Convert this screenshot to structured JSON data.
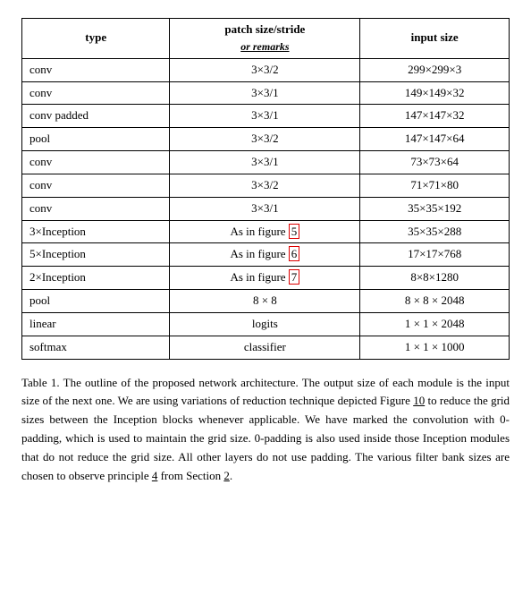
{
  "table": {
    "headers": [
      {
        "label": "type",
        "subLabel": ""
      },
      {
        "label": "patch size/stride",
        "subLabel": "or remarks"
      },
      {
        "label": "input size",
        "subLabel": ""
      }
    ],
    "rows": [
      {
        "type": "conv",
        "patch": "3×3/2",
        "input": "299×299×3",
        "highlight": false
      },
      {
        "type": "conv",
        "patch": "3×3/1",
        "input": "149×149×32",
        "highlight": false
      },
      {
        "type": "conv padded",
        "patch": "3×3/1",
        "input": "147×147×32",
        "highlight": false
      },
      {
        "type": "pool",
        "patch": "3×3/2",
        "input": "147×147×64",
        "highlight": false
      },
      {
        "type": "conv",
        "patch": "3×3/1",
        "input": "73×73×64",
        "highlight": false
      },
      {
        "type": "conv",
        "patch": "3×3/2",
        "input": "71×71×80",
        "highlight": false
      },
      {
        "type": "conv",
        "patch": "3×3/1",
        "input": "35×35×192",
        "highlight": false
      },
      {
        "type": "3×Inception",
        "patch": "As in figure 5",
        "input": "35×35×288",
        "highlight": true,
        "figNum": "5"
      },
      {
        "type": "5×Inception",
        "patch": "As in figure 6",
        "input": "17×17×768",
        "highlight": true,
        "figNum": "6"
      },
      {
        "type": "2×Inception",
        "patch": "As in figure 7",
        "input": "8×8×1280",
        "highlight": true,
        "figNum": "7"
      },
      {
        "type": "pool",
        "patch": "8 × 8",
        "input": "8 × 8 × 2048",
        "highlight": false
      },
      {
        "type": "linear",
        "patch": "logits",
        "input": "1 × 1 × 2048",
        "highlight": false
      },
      {
        "type": "softmax",
        "patch": "classifier",
        "input": "1 × 1 × 1000",
        "highlight": false
      }
    ]
  },
  "caption": {
    "prefix": "Table 1. The outline of the proposed network architecture.  The output size of each module is the input size of the next one.  We are using variations of reduction technique depicted Figure ",
    "link1": "10",
    "middle1": " to reduce the grid sizes between the Inception blocks whenever applicable.  We have marked the convolution with 0-padding, which is used to maintain the grid size.  0-padding is also used inside those Inception modules that do not reduce the grid size.  All other layers do not use padding.  The various filter bank sizes are chosen to observe principle ",
    "link2": "4",
    "middle2": " from Section ",
    "link3": "2",
    "suffix": "."
  }
}
